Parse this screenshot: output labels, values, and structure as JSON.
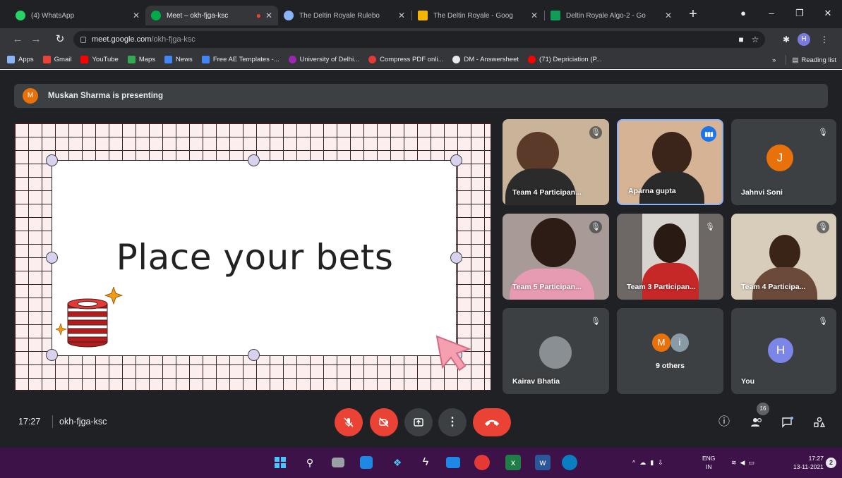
{
  "browser": {
    "tabs": [
      {
        "title": "(4) WhatsApp",
        "color": "#25d366"
      },
      {
        "title": "Meet – okh-fjga-ksc",
        "color": "#00ac47",
        "active": true,
        "recording": true
      },
      {
        "title": "The Deltin Royale Rulebo",
        "color": "#8ab4f8"
      },
      {
        "title": "The Deltin Royale - Goog",
        "color": "#f4b400"
      },
      {
        "title": "Deltin Royale Algo-2 - Go",
        "color": "#0f9d58"
      }
    ],
    "url_host": "meet.google.com",
    "url_path": "/okh-fjga-ksc",
    "profile_initial": "H",
    "bookmarks": [
      {
        "label": "Apps",
        "color": "#8ab4f8"
      },
      {
        "label": "Gmail",
        "color": "#ea4335"
      },
      {
        "label": "YouTube",
        "color": "#ff0000"
      },
      {
        "label": "Maps",
        "color": "#34a853"
      },
      {
        "label": "News",
        "color": "#4285f4"
      },
      {
        "label": "Free AE Templates -...",
        "color": "#4285f4"
      },
      {
        "label": "University of Delhi...",
        "color": "#9c27b0"
      },
      {
        "label": "Compress PDF onli...",
        "color": "#e53935"
      },
      {
        "label": "DM - Answersheet",
        "color": "#e8eaed"
      },
      {
        "label": "(71) Depriciation (P...",
        "color": "#ff0000"
      }
    ],
    "reading_list": "Reading list"
  },
  "meet": {
    "presenter_banner": "Muskan Sharma is presenting",
    "presenter_initial": "M",
    "slide_title": "Place your bets",
    "participants": [
      {
        "name": "Team 4 Participan...",
        "muted": true
      },
      {
        "name": "Aparna gupta",
        "speaking": true
      },
      {
        "name": "Jahnvi Soni",
        "muted": true,
        "initial": "J",
        "avatar_color": "#e8710a"
      },
      {
        "name": "Team 5 Participan...",
        "muted": true
      },
      {
        "name": "Team 3 Participan...",
        "muted": true
      },
      {
        "name": "Team 4 Participa...",
        "muted": true
      },
      {
        "name": "Kairav Bhatia",
        "muted": true
      },
      {
        "name": "9 others",
        "initials": [
          "M",
          "i"
        ]
      },
      {
        "name": "You",
        "muted": true,
        "initial": "H",
        "avatar_color": "#7b86e8"
      }
    ],
    "time": "17:27",
    "meeting_code": "okh-fjga-ksc",
    "participant_count": "16"
  },
  "taskbar": {
    "lang_line1": "ENG",
    "lang_line2": "IN",
    "time": "17:27",
    "date": "13-11-2021",
    "notification_count": "2"
  }
}
